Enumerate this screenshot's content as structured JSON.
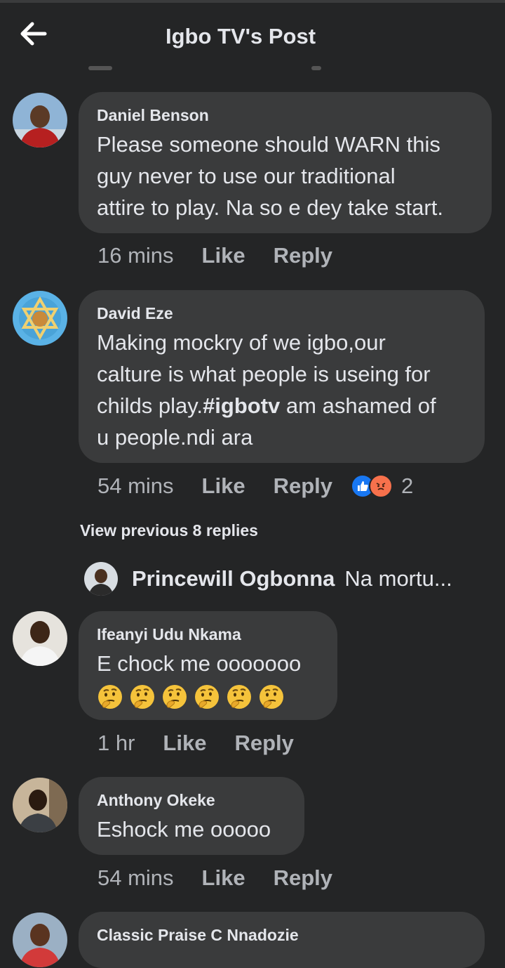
{
  "header": {
    "title": "Igbo TV's Post"
  },
  "comments": [
    {
      "author": "Daniel Benson",
      "text": "Please someone should WARN this\nguy never to use our traditional\nattire to play. Na so e dey take start.",
      "time": "16 mins",
      "like": "Like",
      "reply": "Reply"
    },
    {
      "author": "David Eze",
      "text_before": "Making mockry of we igbo,our\ncalture is what people is useing for\nchilds play.",
      "hashtag": "#igbotv",
      "text_after": " am ashamed of\nu people.ndi ara",
      "time": "54 mins",
      "like": "Like",
      "reply": "Reply",
      "reaction_count": "2",
      "reactions": [
        "like",
        "angry"
      ]
    },
    {
      "author": "Ifeanyi Udu Nkama",
      "text": "E chock me ooooooo",
      "emoji_count": 6,
      "emoji": "thinking-face",
      "time": "1 hr",
      "like": "Like",
      "reply": "Reply"
    },
    {
      "author": "Anthony Okeke",
      "text": "Eshock me ooooo",
      "time": "54 mins",
      "like": "Like",
      "reply": "Reply"
    },
    {
      "author": "Classic Praise C Nnadozie"
    }
  ],
  "replies": {
    "view_previous": "View previous 8 replies",
    "preview_author": "Princewill Ogbonna",
    "preview_text": "Na mortu..."
  },
  "colors": {
    "background": "#242526",
    "bubble": "#3a3b3c",
    "text": "#e4e6eb",
    "meta": "#b0b3b8",
    "like_blue": "#1877f2",
    "angry_orange": "#f7714c"
  }
}
